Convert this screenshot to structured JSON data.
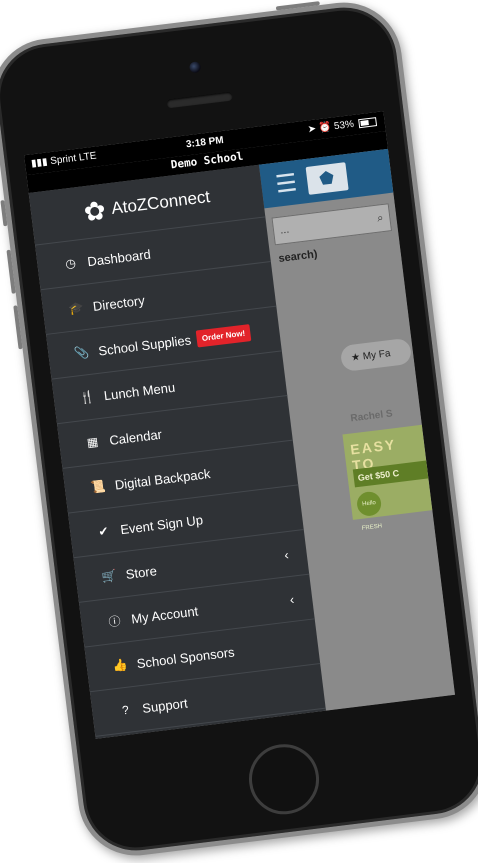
{
  "status": {
    "carrier": "Sprint  LTE",
    "time": "3:18 PM",
    "battery": "53%"
  },
  "title": "Demo School",
  "brand": {
    "logo_text": "AtoZConnect"
  },
  "menu": [
    {
      "label": "Dashboard",
      "icon": "clock-icon"
    },
    {
      "label": "Directory",
      "icon": "graduation-cap-icon"
    },
    {
      "label": "School Supplies",
      "icon": "paperclip-icon",
      "badge": "Order Now!"
    },
    {
      "label": "Lunch Menu",
      "icon": "utensils-icon"
    },
    {
      "label": "Calendar",
      "icon": "calendar-icon"
    },
    {
      "label": "Digital Backpack",
      "icon": "scroll-icon"
    },
    {
      "label": "Event Sign Up",
      "icon": "check-icon"
    },
    {
      "label": "Store",
      "icon": "cart-icon",
      "chevron": "‹"
    },
    {
      "label": "My Account",
      "icon": "info-icon",
      "chevron": "‹"
    },
    {
      "label": "School Sponsors",
      "icon": "thumbs-up-icon"
    },
    {
      "label": "Support",
      "icon": "question-icon"
    }
  ],
  "background_page": {
    "search_placeholder": "...",
    "search_hint": "search)",
    "fav_button": "My Fa",
    "sponsor_name": "Rachel S",
    "ad_headline": "EASY TO",
    "ad_cta": "Get $50 C",
    "ad_logo": "Hello FRESH"
  },
  "colors": {
    "drawer": "#2f3236",
    "badge": "#e2232a",
    "topbar": "#205b86"
  }
}
